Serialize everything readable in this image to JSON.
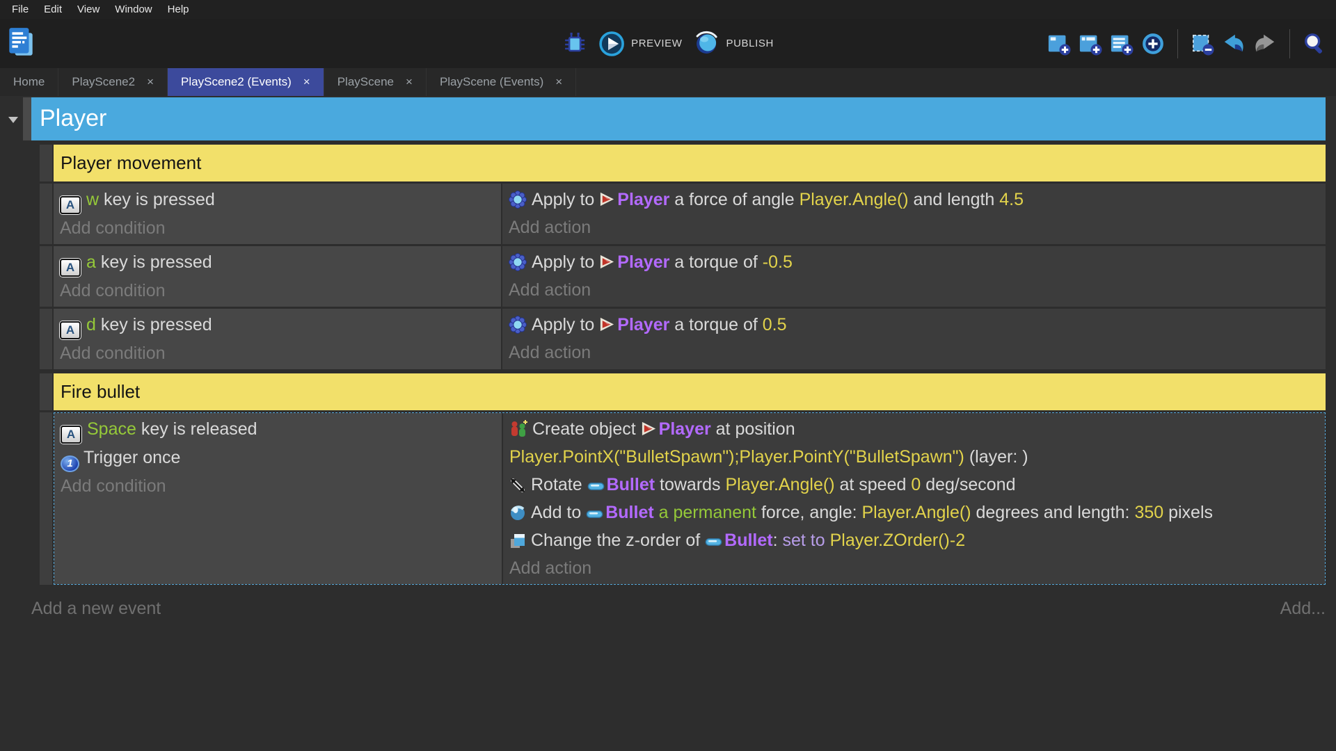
{
  "menu": {
    "items": [
      "File",
      "Edit",
      "View",
      "Window",
      "Help"
    ]
  },
  "toolbar": {
    "preview_label": "PREVIEW",
    "publish_label": "PUBLISH",
    "left_icon": "gdevelop-projects-icon",
    "center_icons": [
      "debug-icon",
      "preview-play-icon",
      "publish-globe-icon"
    ],
    "right_icons": [
      "add-event-icon",
      "add-subevent-icon",
      "add-comment-icon",
      "choose-add-event-icon",
      "delete-event-icon",
      "undo-icon",
      "redo-icon",
      "search-icon"
    ]
  },
  "tabs": [
    {
      "label": "Home"
    },
    {
      "label": "PlayScene2",
      "close": "×"
    },
    {
      "label": "PlayScene2 (Events)",
      "close": "×",
      "active": true
    },
    {
      "label": "PlayScene",
      "close": "×"
    },
    {
      "label": "PlayScene (Events)",
      "close": "×"
    }
  ],
  "sheet": {
    "group_title": "Player",
    "section_movement": "Player movement",
    "section_fire": "Fire bullet",
    "labels": {
      "add_condition": "Add condition",
      "add_action": "Add action",
      "add_new_event": "Add a new event",
      "add_more": "Add..."
    },
    "icons": {
      "key_letter": "A",
      "trigger_glyph": "1"
    },
    "e1": {
      "c_key": "w",
      "c_rest": " key is pressed",
      "a": {
        "t1": "Apply to ",
        "obj": "Player",
        "t2": " a force of angle ",
        "x1": "Player.Angle()",
        "t3": " and length ",
        "x2": "4.5"
      }
    },
    "e2": {
      "c_key": "a",
      "c_rest": " key is pressed",
      "a": {
        "t1": "Apply to ",
        "obj": "Player",
        "t2": " a torque of ",
        "x1": "-0.5"
      }
    },
    "e3": {
      "c_key": "d",
      "c_rest": " key is pressed",
      "a": {
        "t1": "Apply to ",
        "obj": "Player",
        "t2": " a torque of ",
        "x1": "0.5"
      }
    },
    "e4": {
      "c1_key": "Space",
      "c1_rest": " key is released",
      "c2": "Trigger once",
      "a1": {
        "t1": "Create object ",
        "obj": "Player",
        "t2": " at position",
        "x1": "Player.PointX(\"BulletSpawn\");Player.PointY(\"BulletSpawn\")",
        "t3": " (layer: )"
      },
      "a2": {
        "t1": "Rotate ",
        "obj": "Bullet",
        "t2": " towards ",
        "x1": "Player.Angle()",
        "t3": " at speed ",
        "x2": "0",
        "t4": " deg/second"
      },
      "a3": {
        "t1": "Add to ",
        "obj": "Bullet",
        "g1": " a permanent",
        "t2": " force, angle: ",
        "x1": "Player.Angle()",
        "t3": " degrees and length: ",
        "x2": "350",
        "t4": " pixels"
      },
      "a4": {
        "t1": "Change the z-order of ",
        "obj": "Bullet",
        "t2": ": ",
        "s1": "set to ",
        "x1": "Player.ZOrder()-2"
      }
    }
  },
  "colors": {
    "group_header_blue": "#4AA9DE",
    "section_yellow": "#F2E06A",
    "active_tab_indigo": "#3C4A9C",
    "object_purple": "#B36AFF",
    "expression_yellow": "#E2D34B",
    "key_green": "#95C939",
    "set_to_purple": "#B79DE8",
    "selection_dashed_blue": "#55A8DA",
    "condition_cell": "#474747",
    "action_cell": "#3C3C3C",
    "sheet_background": "#2D2D2D"
  }
}
